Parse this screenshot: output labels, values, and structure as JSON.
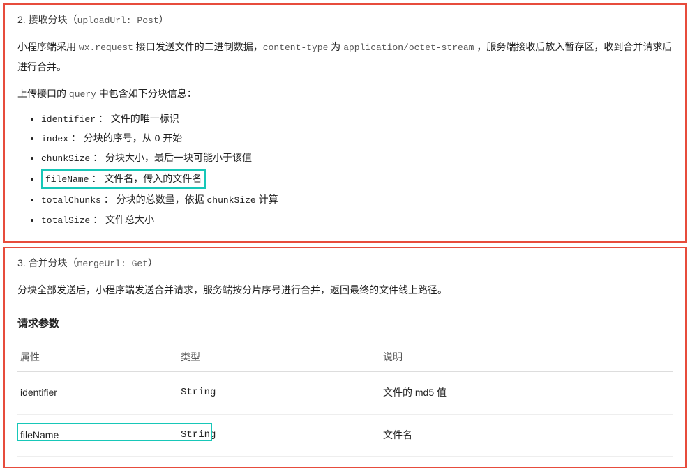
{
  "panel1": {
    "title_prefix": "2. 接收分块（",
    "title_code": "uploadUrl: Post",
    "title_suffix": "）",
    "p1_a": "小程序端采用 ",
    "p1_api": "wx.request",
    "p1_b": " 接口发送文件的二进制数据，",
    "p1_c": "content-type",
    "p1_d": " 为 ",
    "p1_e": "application/octet-stream",
    "p1_f": " ，服务端接收后放入暂存区，收到合并请求后进行合并。",
    "p2_a": "上传接口的 ",
    "p2_b": "query",
    "p2_c": " 中包含如下分块信息：",
    "items": [
      {
        "code": "identifier",
        "text": " ： 文件的唯一标识"
      },
      {
        "code": "index",
        "text": " ： 分块的序号，从 0 开始"
      },
      {
        "code": "chunkSize",
        "text": " ： 分块大小，最后一块可能小于该值"
      },
      {
        "code": "fileName",
        "text": " ： 文件名，传入的文件名",
        "highlight": true
      },
      {
        "code": "totalChunks",
        "t1": " ： 分块的总数量，依据 ",
        "code2": "chunkSize",
        "t2": " 计算"
      },
      {
        "code": "totalSize",
        "text": " ： 文件总大小"
      }
    ]
  },
  "panel2": {
    "title_prefix": "3. 合并分块（",
    "title_code": "mergeUrl: Get",
    "title_suffix": "）",
    "p1": "分块全部发送后，小程序端发送合并请求，服务端按分片序号进行合并，返回最终的文件线上路径。",
    "req_heading": "请求参数",
    "th_attr": "属性",
    "th_type": "类型",
    "th_desc": "说明",
    "rows": [
      {
        "attr": "identifier",
        "type": "String",
        "desc": "文件的 md5 值"
      },
      {
        "attr": "fileName",
        "type": "String",
        "desc": "文件名",
        "highlight": true
      }
    ]
  }
}
